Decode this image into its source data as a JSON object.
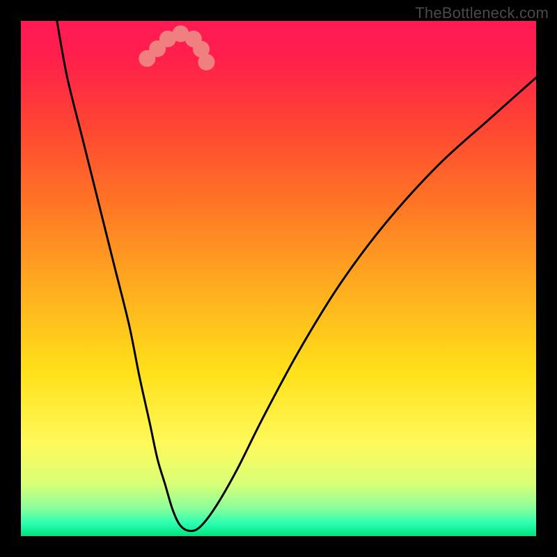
{
  "watermark": {
    "text": "TheBottleneck.com"
  },
  "chart_data": {
    "type": "line",
    "title": "",
    "xlabel": "",
    "ylabel": "",
    "xlim": [
      0,
      100
    ],
    "ylim": [
      0,
      100
    ],
    "gradient_stops": [
      {
        "offset": 0.0,
        "color": "#ff1a53"
      },
      {
        "offset": 0.07,
        "color": "#ff1f4c"
      },
      {
        "offset": 0.2,
        "color": "#ff4433"
      },
      {
        "offset": 0.35,
        "color": "#ff7426"
      },
      {
        "offset": 0.52,
        "color": "#ffad1f"
      },
      {
        "offset": 0.68,
        "color": "#ffe019"
      },
      {
        "offset": 0.82,
        "color": "#fff95a"
      },
      {
        "offset": 0.9,
        "color": "#d7ff78"
      },
      {
        "offset": 0.945,
        "color": "#8cff9a"
      },
      {
        "offset": 0.975,
        "color": "#2bffb2"
      },
      {
        "offset": 1.0,
        "color": "#00e07a"
      }
    ],
    "series": [
      {
        "name": "bottleneck-curve",
        "x": [
          7,
          9,
          12,
          15,
          18,
          21,
          23,
          25,
          26.5,
          28,
          29.5,
          31,
          33,
          35,
          38,
          42,
          47,
          54,
          62,
          71,
          81,
          91,
          100
        ],
        "y": [
          100,
          89,
          77,
          65,
          53,
          41,
          31,
          22,
          15,
          10,
          5,
          2,
          1,
          2,
          6,
          13,
          23,
          36,
          49,
          61,
          72,
          81,
          89
        ]
      }
    ],
    "markers": {
      "name": "highlight-markers",
      "color": "#f08080",
      "radius_px": 12,
      "points_xy": [
        [
          24.5,
          92.7
        ],
        [
          26.5,
          94.6
        ],
        [
          28.5,
          96.5
        ],
        [
          31.0,
          97.5
        ],
        [
          33.5,
          96.5
        ],
        [
          35.0,
          94.5
        ],
        [
          36.0,
          92.0
        ]
      ]
    }
  }
}
